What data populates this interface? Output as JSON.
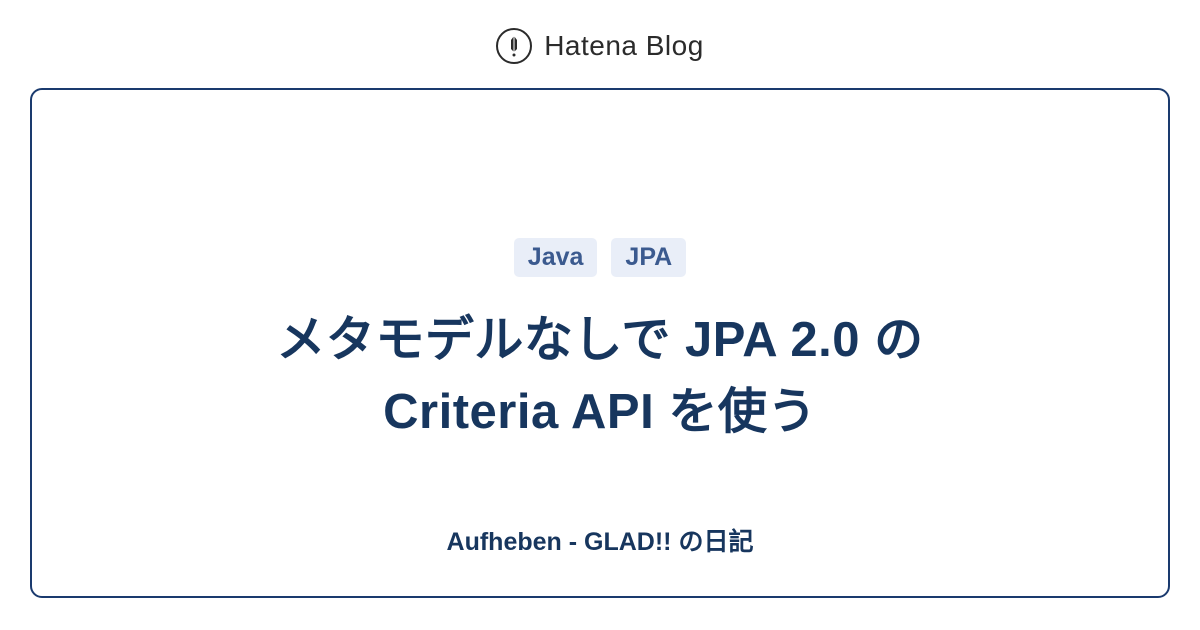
{
  "header": {
    "brand": "Hatena Blog"
  },
  "card": {
    "tags": [
      "Java",
      "JPA"
    ],
    "title_line1": "メタモデルなしで JPA 2.0 の",
    "title_line2": "Criteria API を使う",
    "subtitle": "Aufheben - GLAD!! の日記"
  }
}
